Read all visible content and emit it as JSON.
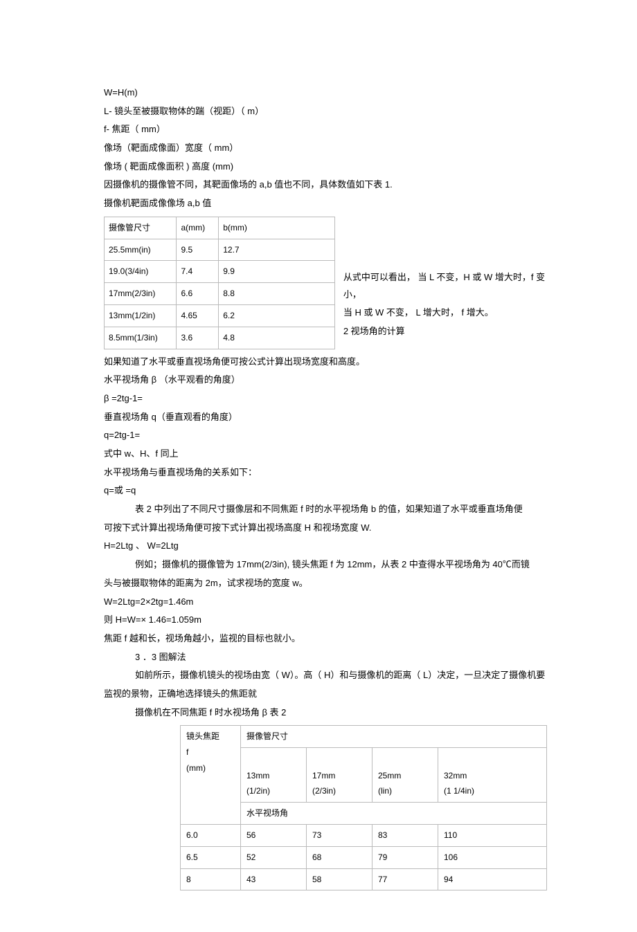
{
  "lines": {
    "l1": "W=H(m)",
    "l2": "L- 镜头至被摄取物体的踹（视距）（   m）",
    "l3": "f- 焦距（ mm）",
    "l4": "像场（靶面成像面）宽度（   mm）",
    "l5": "像场 ( 靶面成像面积  ) 高度 (mm)",
    "l6": "因摄像机的摄像管不同，其靶面像场的      a,b 值也不同，具体数值如下表     1.",
    "l7": "摄像机靶面成像像场   a,b 值",
    "side1": "从式中可以看出，  当 L 不变，H 或 W 增大时，f 变小，",
    "side2": "当 H 或 W 不变， L 增大时， f 增大。",
    "side3": "2 视场角的计算",
    "l8": "如果知道了水平或垂直视场角便可按公式计算出现场宽度和高度。",
    "l9": "水平视场角 β （水平观看的角度）",
    "l10": "β =2tg-1=",
    "l11": "垂直视场角  q（垂直观看的角度）",
    "l12": "q=2tg-1=",
    "l13": "式中 w、H、f 同上",
    "l14": "水平视场角与垂直视场角的关系如下：",
    "l15": "q=或 =q",
    "l16": "表 2 中列出了不同尺寸摄像层和不同焦距 f 时的水平视场角   b 的值，如果知道了水平或垂直场角便",
    "l17": "可按下式计算出视场角便可按下式计算出视场高度 H 和视场宽度 W.",
    "l18": "H=2Ltg 、 W=2Ltg",
    "l19": "例如；摄像机的摄像管为    17mm(2/3in),  镜头焦距  f 为 12mm，从表 2 中查得水平视场角为    40℃而镜",
    "l20": "头与被摄取物体的距离为    2m，试求视场的宽度   w。",
    "l21": "W=2Ltg=2×2tg=1.46m",
    "l22": "则 H=W=× 1.46=1.059m",
    "l23": "焦距 f 越和长，视场角越小，监视的目标也就小。",
    "l24": "3 ．3 图解法",
    "l25": "如前所示，摄像机镜头的视场由宽（ W）。高（ H）和与摄像机的距离（ L）决定，一旦决定了摄像机要",
    "l26": "监视的景物，正确地选择镜头的焦距就",
    "l27": "摄像机在不同焦距   f 时水视场角 β 表  2"
  },
  "chart_data": [
    {
      "type": "table",
      "title": "摄像机靶面成像像场 a,b 值",
      "columns": [
        "摄像管尺寸",
        "a(mm)",
        "b(mm)"
      ],
      "rows": [
        [
          "25.5mm(in)",
          "9.5",
          "12.7"
        ],
        [
          "19.0(3/4in)",
          "7.4",
          "9.9"
        ],
        [
          "17mm(2/3in)",
          "6.6",
          "8.8"
        ],
        [
          "13mm(1/2in)",
          "4.65",
          "6.2"
        ],
        [
          "8.5mm(1/3in)",
          "3.6",
          "4.8"
        ]
      ]
    },
    {
      "type": "table",
      "title": "摄像机在不同焦距 f 时水视场角 β 表 2",
      "header_group": "摄像管尺寸",
      "row_header": "镜头焦距\nf\n(mm)",
      "sub_columns": [
        "13mm\n(1/2in)",
        "17mm\n(2/3in)",
        "25mm\n(lin)",
        "32mm\n(1 1/4in)"
      ],
      "span_label": "水平视场角",
      "rows": [
        [
          "6.0",
          "56",
          "73",
          "83",
          "110"
        ],
        [
          "6.5",
          "52",
          "68",
          "79",
          "106"
        ],
        [
          "8",
          "43",
          "58",
          "77",
          "94"
        ]
      ]
    }
  ]
}
